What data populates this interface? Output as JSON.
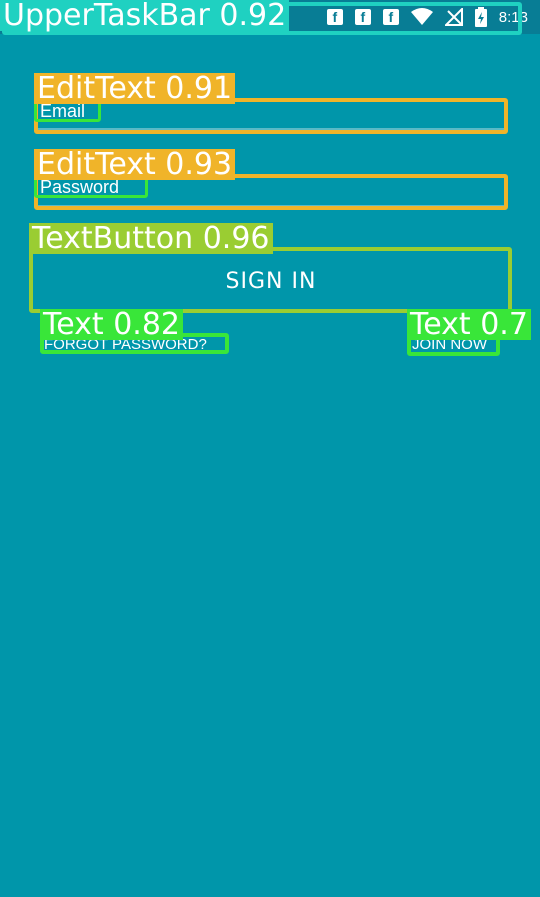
{
  "statusbar": {
    "time": "8:13",
    "icons": [
      "facebook-icon",
      "facebook-icon",
      "facebook-icon",
      "wifi-icon",
      "no-signal-icon",
      "battery-icon"
    ]
  },
  "form": {
    "email_placeholder": "Email",
    "password_placeholder": "Password",
    "signin_label": "SIGN IN",
    "forgot_label": "FORGOT PASSWORD?",
    "join_label": "JOIN NOW"
  },
  "overlay": {
    "upper_taskbar": "UpperTaskBar 0.92",
    "email_field": "EditText 0.91",
    "password_field": "EditText 0.93",
    "signin_button": "TextButton 0.96",
    "forgot_text": "Text 0.82",
    "join_text": "Text 0.7"
  },
  "colors": {
    "background": "#0096aa",
    "statusbar": "#087d95",
    "edittext_box": "#f0b429",
    "textbutton_box": "#9acd32",
    "text_box": "#39e639",
    "taskbar_box": "#1fd1c1"
  }
}
